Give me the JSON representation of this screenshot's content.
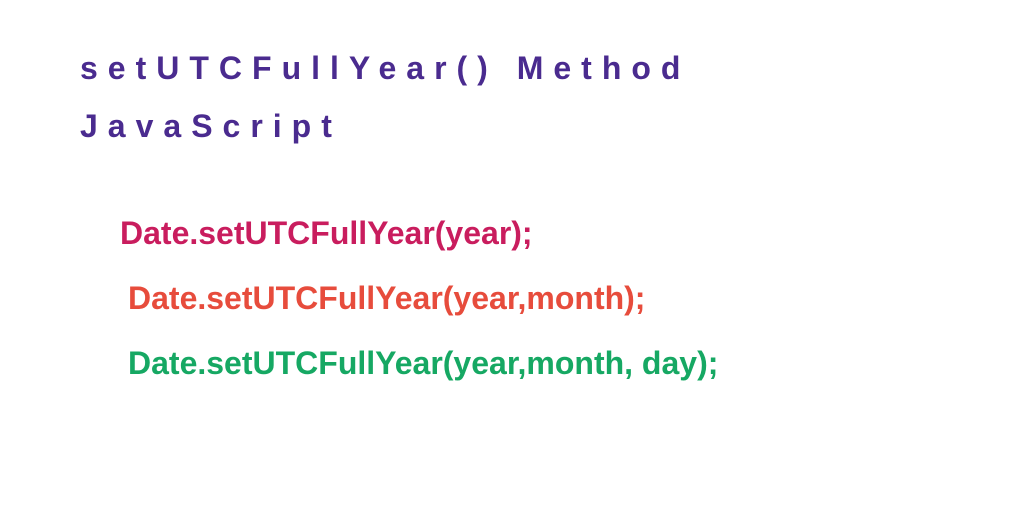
{
  "title": "setUTCFullYear() Method JavaScript",
  "syntax": {
    "line1": "Date.setUTCFullYear(year);",
    "line2": "Date.setUTCFullYear(year,month);",
    "line3": "Date.setUTCFullYear(year,month, day);"
  }
}
